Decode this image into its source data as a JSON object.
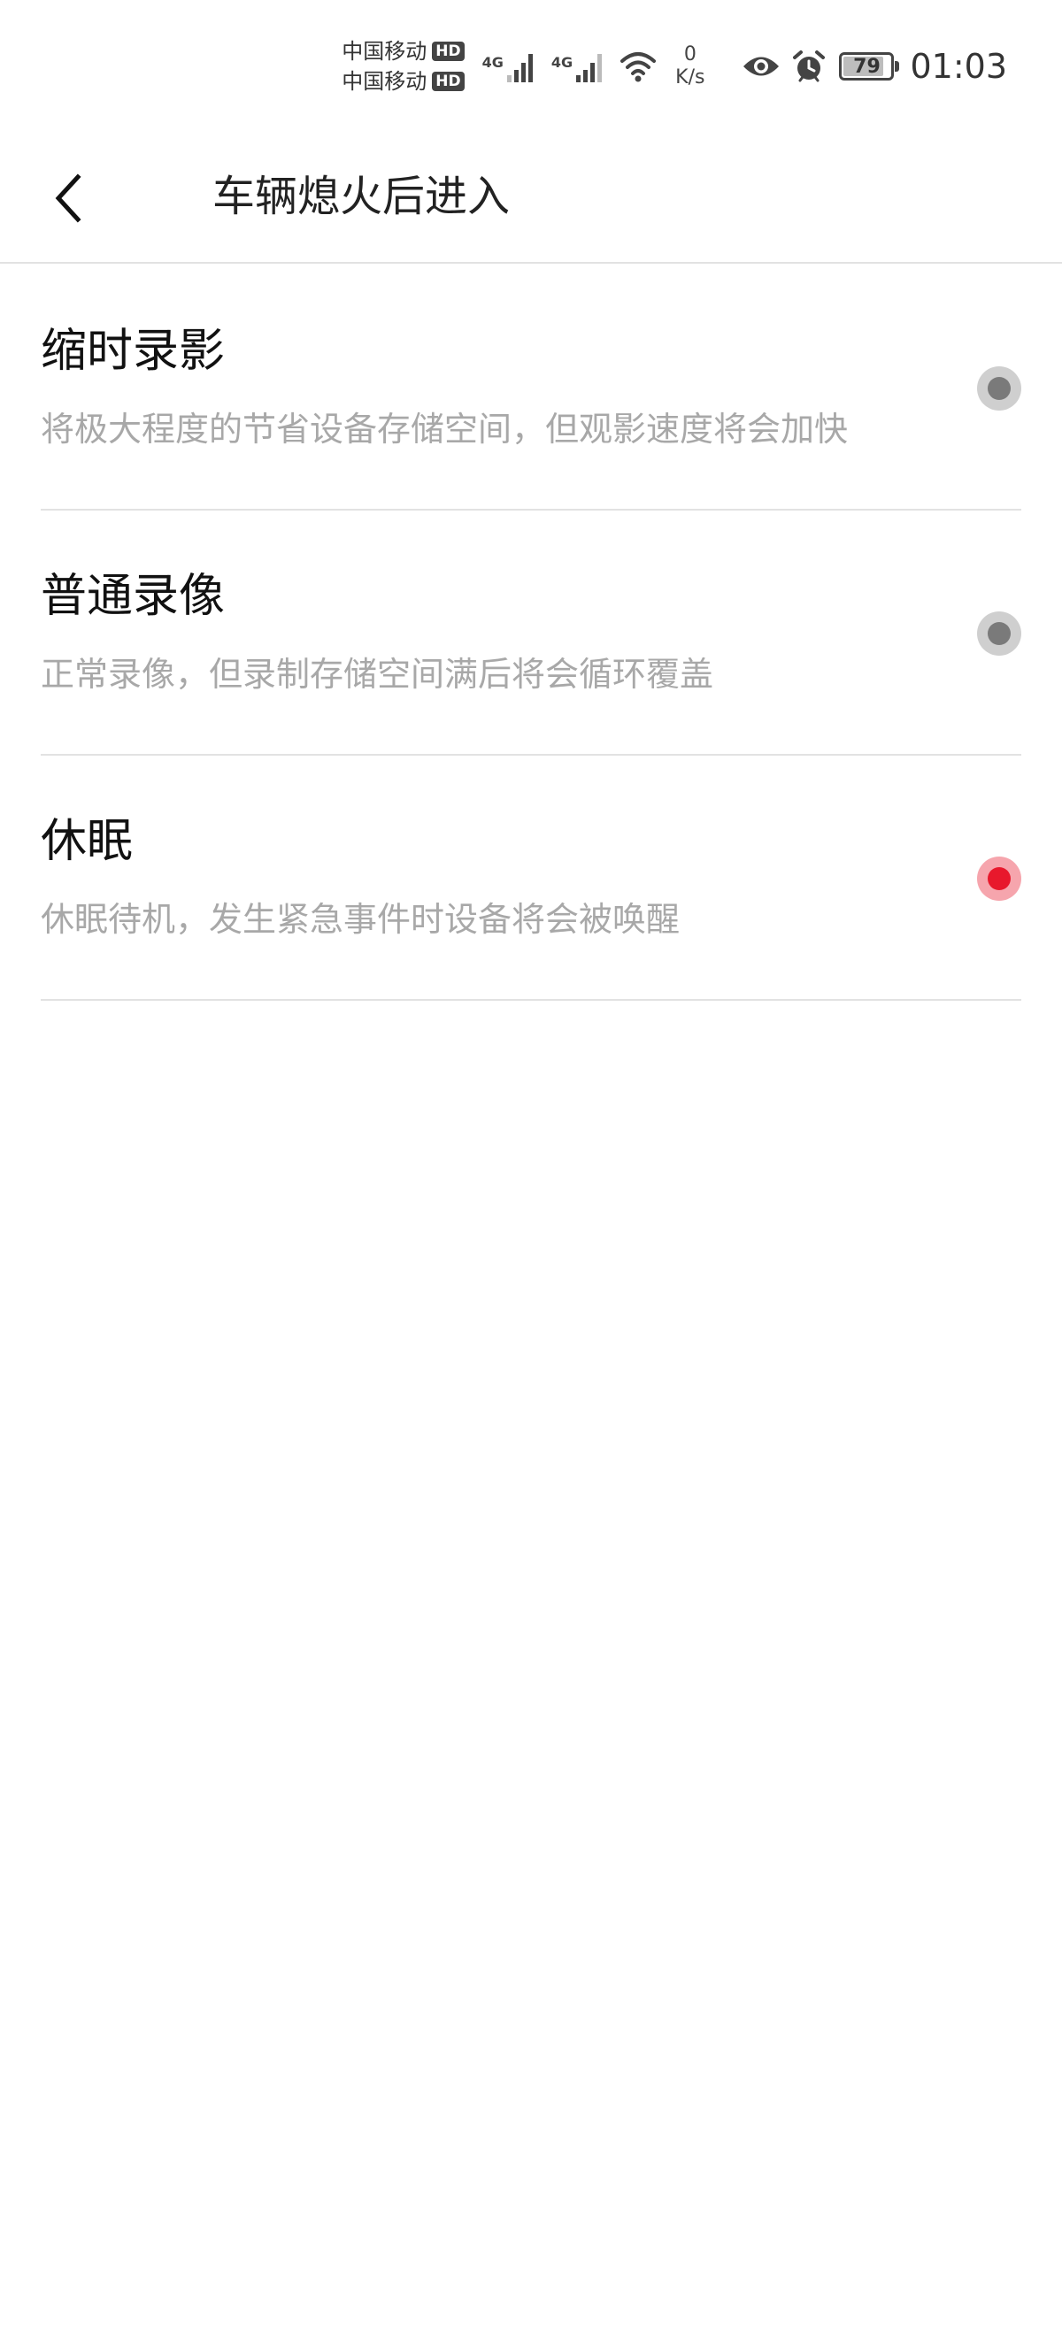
{
  "status_bar": {
    "carriers": [
      {
        "name": "中国移动",
        "badge": "HD"
      },
      {
        "name": "中国移动",
        "badge": "HD"
      }
    ],
    "signal_labels": [
      "4G",
      "4G"
    ],
    "net_speed_value": "0",
    "net_speed_unit": "K/s",
    "battery_level": "79",
    "time": "01:03",
    "icons": [
      "signal-icon",
      "signal-icon",
      "wifi-icon",
      "eye-icon",
      "alarm-icon",
      "battery-icon"
    ]
  },
  "header": {
    "back_icon": "chevron-left-icon",
    "title": "车辆熄火后进入"
  },
  "options": [
    {
      "title": "缩时录影",
      "description": "将极大程度的节省设备存储空间，但观影速度将会加快",
      "selected": false
    },
    {
      "title": "普通录像",
      "description": "正常录像，但录制存储空间满后将会循环覆盖",
      "selected": false
    },
    {
      "title": "休眠",
      "description": "休眠待机，发生紧急事件时设备将会被唤醒",
      "selected": true
    }
  ],
  "colors": {
    "accent": "#e8182c",
    "accent_ring": "#f6a5ad",
    "radio_off_ring": "#cfcfcf",
    "radio_off_dot": "#7a7a7a",
    "description_text": "#a8a8a8",
    "divider": "#e2e2e2"
  }
}
